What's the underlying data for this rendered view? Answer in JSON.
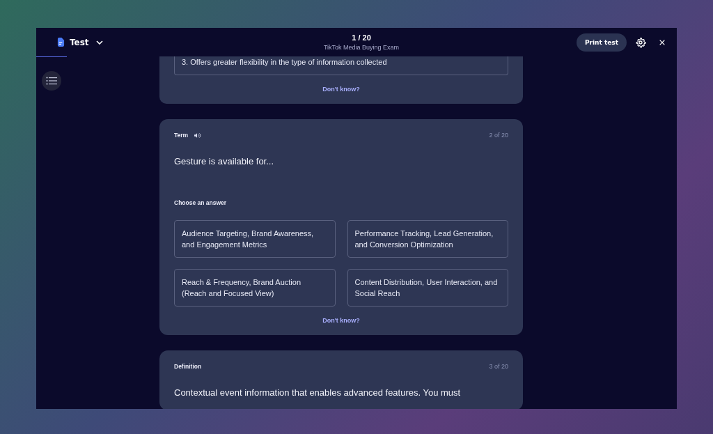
{
  "header": {
    "menu_title": "Test",
    "counter": "1 / 20",
    "subtitle": "TikTok Media Buying Exam",
    "print_button": "Print test"
  },
  "previous_card": {
    "options": [
      "3. Offers greater flexibility in the type of information collected"
    ],
    "dont_know": "Don't know?"
  },
  "cards": [
    {
      "kind": "choice",
      "label": "Term",
      "audio": true,
      "counter": "2 of 20",
      "question": "Gesture is available for...",
      "prompt": "Choose an answer",
      "options": [
        "Audience Targeting, Brand Awareness, and Engagement Metrics",
        "Performance Tracking, Lead Generation, and Conversion Optimization",
        "Reach & Frequency, Brand Auction (Reach and Focused View)",
        "Content Distribution, User Interaction, and Social Reach"
      ],
      "dont_know": "Don't know?"
    },
    {
      "kind": "text",
      "label": "Definition",
      "audio": false,
      "counter": "3 of 20",
      "question": "Contextual event information that enables advanced features. You must"
    }
  ]
}
